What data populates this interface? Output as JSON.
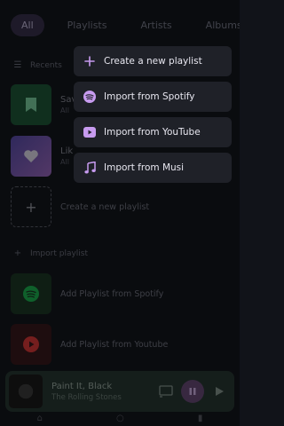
{
  "tabs": [
    {
      "label": "All"
    },
    {
      "label": "Playlists"
    },
    {
      "label": "Artists"
    },
    {
      "label": "Albums"
    }
  ],
  "recents_label": "Recents",
  "library_rows": [
    {
      "title": "Sav",
      "subtitle": "All"
    },
    {
      "title": "Lik",
      "subtitle": "All"
    }
  ],
  "create_label": "Create a new playlist",
  "import_section_label": "Import playlist",
  "import_rows": [
    {
      "label": "Add Playlist from Spotify"
    },
    {
      "label": "Add Playlist from Youtube"
    }
  ],
  "menu": {
    "items": [
      {
        "label": "Create a new playlist",
        "icon": "plus-icon"
      },
      {
        "label": "Import from Spotify",
        "icon": "spotify-icon"
      },
      {
        "label": "Import from YouTube",
        "icon": "youtube-icon"
      },
      {
        "label": "Import from Musi",
        "icon": "music-note-icon"
      }
    ]
  },
  "player": {
    "title": "Paint It, Black",
    "artist": "The Rolling Stones"
  },
  "colors": {
    "accent": "#c79bef",
    "spotify": "#1db954",
    "youtube": "#e03b3b"
  }
}
